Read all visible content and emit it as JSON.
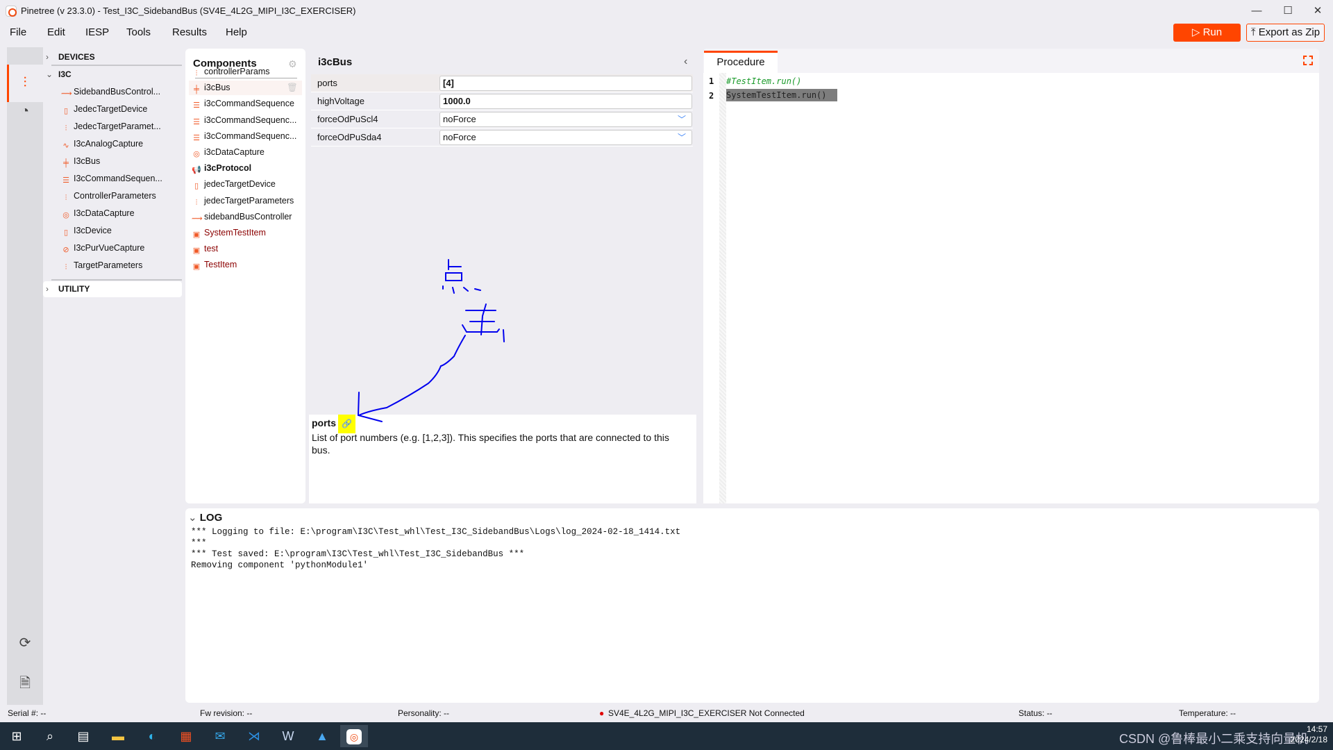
{
  "window": {
    "title": "Pinetree (v 23.3.0) - Test_I3C_SidebandBus (SV4E_4L2G_MIPI_I3C_EXERCISER)",
    "minimize": "—",
    "maximize": "☐",
    "close": "✕"
  },
  "menu": [
    "File",
    "Edit",
    "IESP",
    "Tools",
    "Results",
    "Help"
  ],
  "toolbar": {
    "run_label": "▷ Run",
    "export_label": "⤒ Export as Zip",
    "accent": "#ff4500"
  },
  "sidebar": {
    "sections": [
      "DEVICES",
      "I3C",
      "UTILITY"
    ],
    "items": [
      {
        "label": "SidebandBusControl...",
        "icon": "sideband-icon",
        "glyph": "⟿"
      },
      {
        "label": "JedecTargetDevice",
        "icon": "device-icon",
        "glyph": "▯"
      },
      {
        "label": "JedecTargetParamet...",
        "icon": "parameters-icon",
        "glyph": "⫶"
      },
      {
        "label": "I3cAnalogCapture",
        "icon": "analog-capture-icon",
        "glyph": "∿"
      },
      {
        "label": "I3cBus",
        "icon": "bus-icon",
        "glyph": "╪"
      },
      {
        "label": "I3cCommandSequen...",
        "icon": "command-sequence-icon",
        "glyph": "☰"
      },
      {
        "label": "ControllerParameters",
        "icon": "parameters-icon",
        "glyph": "⫶"
      },
      {
        "label": "I3cDataCapture",
        "icon": "data-capture-icon",
        "glyph": "◎"
      },
      {
        "label": "I3cDevice",
        "icon": "device-icon",
        "glyph": "▯"
      },
      {
        "label": "I3cPurVueCapture",
        "icon": "purvue-capture-icon",
        "glyph": "⊘"
      },
      {
        "label": "TargetParameters",
        "icon": "parameters-icon",
        "glyph": "⫶"
      }
    ]
  },
  "components": {
    "title": "Components",
    "items": [
      {
        "label": "controllerParams",
        "glyph": "⫶"
      },
      {
        "label": "i3cBus",
        "glyph": "╪",
        "selected": true
      },
      {
        "label": "i3cCommandSequence",
        "glyph": "☰"
      },
      {
        "label": "i3cCommandSequenc...",
        "glyph": "☰"
      },
      {
        "label": "i3cCommandSequenc...",
        "glyph": "☰"
      },
      {
        "label": "i3cDataCapture",
        "glyph": "◎"
      },
      {
        "label": "i3cProtocol",
        "glyph": "📢",
        "bold": true
      },
      {
        "label": "jedecTargetDevice",
        "glyph": "▯"
      },
      {
        "label": "jedecTargetParameters",
        "glyph": "⫶"
      },
      {
        "label": "sidebandBusController",
        "glyph": "⟿"
      },
      {
        "label": "SystemTestItem",
        "glyph": "▣",
        "script": true
      },
      {
        "label": "test",
        "glyph": "▣",
        "script": true
      },
      {
        "label": "TestItem",
        "glyph": "▣",
        "script": true
      }
    ]
  },
  "properties": {
    "title": "i3cBus",
    "rows": [
      {
        "label": "ports",
        "value": "[4]"
      },
      {
        "label": "highVoltage",
        "value": "1000.0"
      },
      {
        "label": "forceOdPuScl4",
        "value": "noForce"
      },
      {
        "label": "forceOdPuSda4",
        "value": "noForce"
      }
    ],
    "description": {
      "name": "ports",
      "text": "List of port numbers (e.g. [1,2,3]). This specifies the ports that are connected to this bus."
    }
  },
  "annotation": {
    "text": "点击",
    "color": "#0000ee"
  },
  "procedure": {
    "tab": "Procedure",
    "lines": [
      {
        "n": "1",
        "code": "#TestItem.run()"
      },
      {
        "n": "2",
        "code": "SystemTestItem.run()"
      }
    ]
  },
  "log": {
    "title": "LOG",
    "text": "*** Logging to file: E:\\program\\I3C\\Test_whl\\Test_I3C_SidebandBus\\Logs\\log_2024-02-18_1414.txt\n***\n*** Test saved: E:\\program\\I3C\\Test_whl\\Test_I3C_SidebandBus ***\nRemoving component 'pythonModule1'"
  },
  "status": {
    "serial": "Serial #:  --",
    "fw": "Fw revision: --",
    "personality": "Personality: --",
    "device": "SV4E_4L2G_MIPI_I3C_EXERCISER  Not Connected",
    "state": "Status: --",
    "temperature": "Temperature: --",
    "dot_color": "#e00000"
  },
  "taskbar": {
    "watermark": "CSDN @鲁棒最小二乘支持向量机",
    "time": "14:57",
    "date": "2024/2/18"
  }
}
